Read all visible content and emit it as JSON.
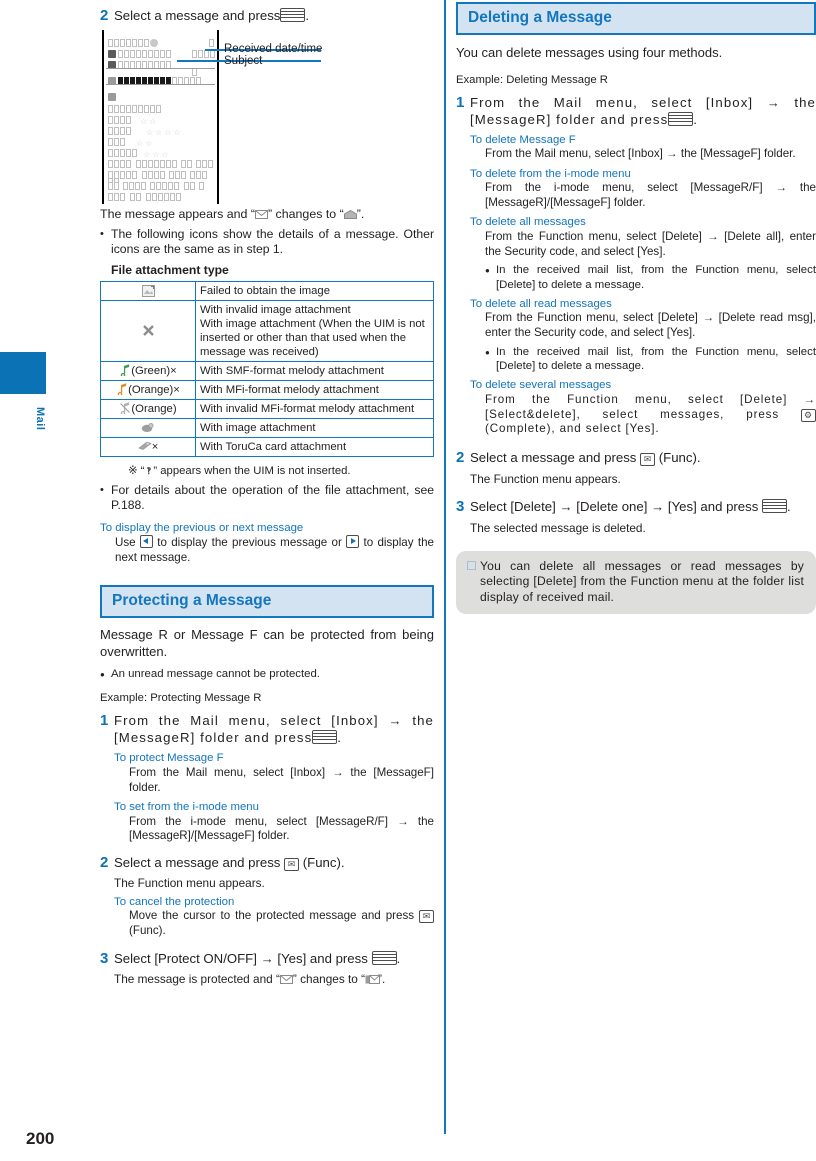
{
  "page": {
    "number": "200",
    "side_tab_label": "Mail",
    "accent_blue": "#1377bd",
    "header_bg": "#d4e3f2",
    "note_bg": "#dededc"
  },
  "left_column": {
    "step2": {
      "num": "2",
      "text_before": "Select a message and press",
      "key": "select-key",
      "text_after": "."
    },
    "figure": {
      "callouts": [
        {
          "label": "Received date/time"
        },
        {
          "label": "Subject"
        }
      ]
    },
    "after_figure": {
      "line": "The message appears and “✉” changes to “✉”.",
      "line_parts": {
        "a": "The message appears and “",
        "b": "” changes to “",
        "c": "”."
      },
      "bullet1": "The following icons show the details of a message. Other icons are the same as in step 1.",
      "table_caption": "File attachment type"
    },
    "icon_table": {
      "rows": [
        {
          "icon": "broken-image-icon",
          "icon_text": "",
          "desc": "Failed to obtain the image"
        },
        {
          "icon": "x-mark-icon",
          "icon_text": "",
          "desc": "With invalid image attachment\nWith image attachment (When the UIM is not inserted or other than that used when the message was received)"
        },
        {
          "icon": "melody-icon",
          "icon_text": "(Green)×",
          "desc": "With SMF-format melody attachment"
        },
        {
          "icon": "melody-icon",
          "icon_text": "(Orange)×",
          "desc": "With MFi-format melody attachment"
        },
        {
          "icon": "melody-invalid-icon",
          "icon_text": "(Orange)",
          "desc": "With invalid MFi-format melody attachment"
        },
        {
          "icon": "image-attachment-icon",
          "icon_text": "",
          "desc": "With image attachment"
        },
        {
          "icon": "toruca-card-icon",
          "icon_text": "×",
          "desc": "With ToruCa card attachment"
        }
      ]
    },
    "footnote": {
      "mark": "※",
      "text_a": " “",
      "text_b": "” appears when the UIM is not inserted."
    },
    "bullet_p188": "For details about the operation of the file attachment, see P.188.",
    "prev_next": {
      "title": "To display the previous or next message",
      "body_a": "Use",
      "body_b": "to display the previous message or",
      "body_c": "to display the next message."
    },
    "protect_section": {
      "header": "Protecting a Message",
      "intro": "Message R or Message F can be protected from being overwritten.",
      "bullet": "An unread message cannot be protected.",
      "example": "Example: Protecting Message R",
      "step1": {
        "num": "1",
        "text_a": "From the Mail menu, select [Inbox] → the [MessageR] folder and press",
        "text_b": "."
      },
      "sub1": {
        "title": "To protect Message F",
        "body": "From the Mail menu, select [Inbox] → the [MessageF] folder."
      },
      "sub2": {
        "title": "To set from the i-mode menu",
        "body": "From the i-mode menu, select [MessageR/F] → the [MessageR]/[MessageF] folder."
      },
      "step2": {
        "num": "2",
        "text_a": "Select a message and press",
        "text_b": "(Func)."
      },
      "step2_note": "The Function menu appears.",
      "sub3": {
        "title": "To cancel the protection",
        "body_a": "Move the cursor to the protected message and press",
        "body_b": "(Func)."
      },
      "step3": {
        "num": "3",
        "text_a": "Select [Protect ON/OFF] → [Yes] and press",
        "text_b": "."
      },
      "step3_note_a": "The message is protected and “",
      "step3_note_b": "” changes to “",
      "step3_note_c": "”."
    }
  },
  "right_column": {
    "header": "Deleting a Message",
    "intro": "You can delete messages using four methods.",
    "example": "Example: Deleting Message R",
    "step1": {
      "num": "1",
      "text_a": "From the Mail menu, select [Inbox] → the [MessageR] folder and press",
      "text_b": "."
    },
    "subs": [
      {
        "title": "To delete Message F",
        "body": "From the Mail menu, select [Inbox] → the [MessageF] folder."
      },
      {
        "title": "To delete from the i-mode menu",
        "body": "From the i-mode menu, select [MessageR/F] → the [MessageR]/[MessageF] folder."
      },
      {
        "title": "To delete all messages",
        "body": "From the Function menu, select [Delete] → [Delete all], enter the Security code, and select [Yes].",
        "bullet": "In the received mail list, from the Function menu, select [Delete] to delete a message."
      },
      {
        "title": "To delete all read messages",
        "body": "From the Function menu, select [Delete] → [Delete read msg], enter the Security code, and select [Yes].",
        "bullet": "In the received mail list, from the Function menu, select [Delete] to delete a message."
      }
    ],
    "sub_several": {
      "title": "To delete several messages",
      "body_a": "From the Function menu, select [Delete] → [Select&delete], select messages, press",
      "body_b": "(Complete), and select [Yes]."
    },
    "step2": {
      "num": "2",
      "text_a": "Select a message and press",
      "text_b": "(Func)."
    },
    "step2_note": "The Function menu appears.",
    "step3": {
      "num": "3",
      "text_a": "Select [Delete] → [Delete one] → [Yes] and press",
      "text_b": "."
    },
    "step3_note": "The selected message is deleted.",
    "note_box": "You can delete all messages or read messages by selecting [Delete] from the Function menu at the folder list display of received mail."
  }
}
